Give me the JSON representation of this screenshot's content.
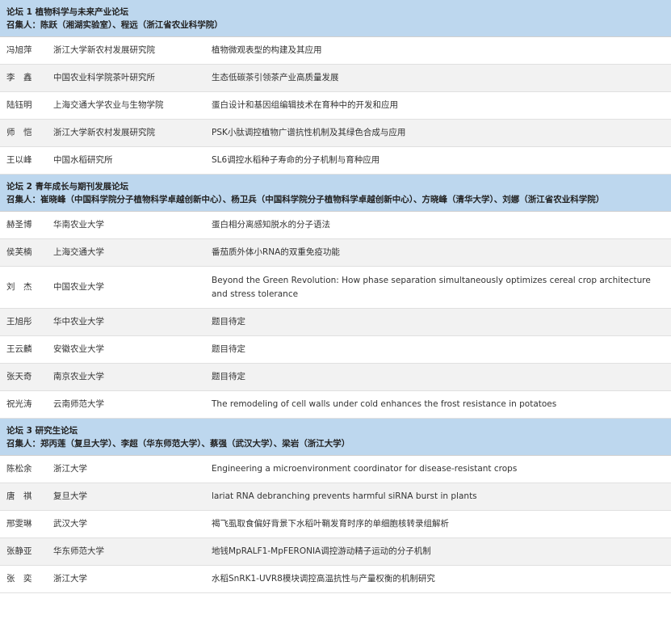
{
  "forums": [
    {
      "title": "论坛 1 植物科学与未来产业论坛",
      "conveners": "召集人：陈跃（湘湖实验室）、程远（浙江省农业科学院）",
      "rows": [
        {
          "name": "冯旭萍",
          "org": "浙江大学新农村发展研究院",
          "topic": "植物微观表型的构建及其应用"
        },
        {
          "name": "李　鑫",
          "org": "中国农业科学院茶叶研究所",
          "topic": "生态低碳茶引领茶产业高质量发展"
        },
        {
          "name": "陆钰明",
          "org": "上海交通大学农业与生物学院",
          "topic": "蛋白设计和基因组编辑技术在育种中的开发和应用"
        },
        {
          "name": "师　恺",
          "org": "浙江大学新农村发展研究院",
          "topic": "PSK小肽调控植物广谱抗性机制及其绿色合成与应用"
        },
        {
          "name": "王以峰",
          "org": "中国水稻研究所",
          "topic": "SL6调控水稻种子寿命的分子机制与育种应用"
        }
      ]
    },
    {
      "title": "论坛 2 青年成长与期刊发展论坛",
      "conveners": "召集人：崔晓峰（中国科学院分子植物科学卓越创新中心）、杨卫兵（中国科学院分子植物科学卓越创新中心）、方晓峰（清华大学）、刘娜（浙江省农业科学院）",
      "rows": [
        {
          "name": "赫圣博",
          "org": "华南农业大学",
          "topic": "蛋白相分离感知脱水的分子语法"
        },
        {
          "name": "侯芙楠",
          "org": "上海交通大学",
          "topic": "番茄质外体小RNA的双重免疫功能"
        },
        {
          "name": "刘　杰",
          "org": "中国农业大学",
          "topic": "Beyond the Green Revolution: How phase separation simultaneously optimizes cereal crop architecture and stress tolerance"
        },
        {
          "name": "王旭彤",
          "org": "华中农业大学",
          "topic": "题目待定"
        },
        {
          "name": "王云麟",
          "org": "安徽农业大学",
          "topic": "题目待定"
        },
        {
          "name": "张天奇",
          "org": "南京农业大学",
          "topic": "题目待定"
        },
        {
          "name": "祝光涛",
          "org": "云南师范大学",
          "topic": "The remodeling of cell walls under cold enhances the frost resistance in potatoes"
        }
      ]
    },
    {
      "title": "论坛 3 研究生论坛",
      "conveners": "召集人：郑丙莲（复旦大学）、李超（华东师范大学）、蔡强（武汉大学）、梁岩（浙江大学）",
      "rows": [
        {
          "name": "陈松余",
          "org": "浙江大学",
          "topic": "Engineering a microenvironment coordinator for disease-resistant crops"
        },
        {
          "name": "唐　祺",
          "org": "复旦大学",
          "topic": "lariat RNA debranching prevents harmful siRNA burst in plants"
        },
        {
          "name": "邢雯琳",
          "org": "武汉大学",
          "topic": "褐飞虱取食偏好背景下水稻叶鞘发育时序的单细胞核转录组解析"
        },
        {
          "name": "张静亚",
          "org": "华东师范大学",
          "topic": "地钱MpRALF1-MpFERONIA调控游动精子运动的分子机制"
        },
        {
          "name": "张　奕",
          "org": "浙江大学",
          "topic": "水稻SnRK1-UVR8模块调控高温抗性与产量权衡的机制研究"
        }
      ]
    }
  ]
}
